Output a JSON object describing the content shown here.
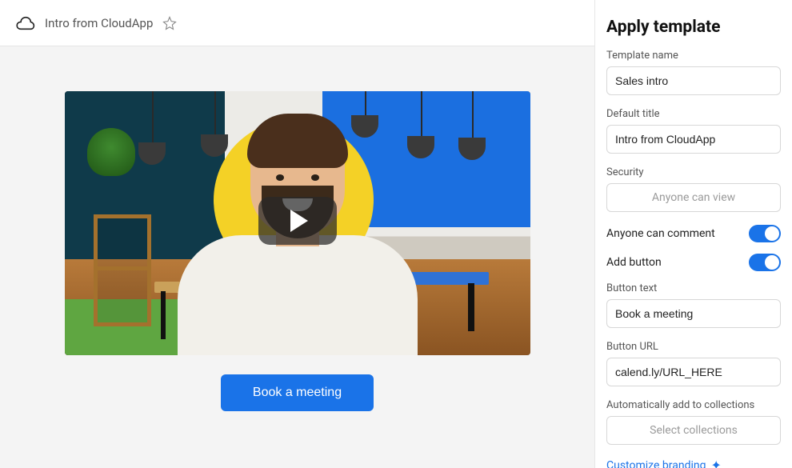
{
  "header": {
    "title": "Intro from CloudApp"
  },
  "main": {
    "cta_label": "Book a meeting"
  },
  "panel": {
    "heading": "Apply template",
    "template_name_label": "Template name",
    "template_name_value": "Sales intro",
    "default_title_label": "Default title",
    "default_title_value": "Intro from CloudApp",
    "security_label": "Security",
    "security_value": "Anyone can view",
    "comment_label": "Anyone can comment",
    "comment_on": true,
    "add_button_label": "Add button",
    "add_button_on": true,
    "button_text_label": "Button text",
    "button_text_value": "Book a meeting",
    "button_url_label": "Button URL",
    "button_url_value": "calend.ly/URL_HERE",
    "collections_label": "Automatically add to collections",
    "collections_placeholder": "Select collections",
    "customize_link": "Customize branding"
  }
}
